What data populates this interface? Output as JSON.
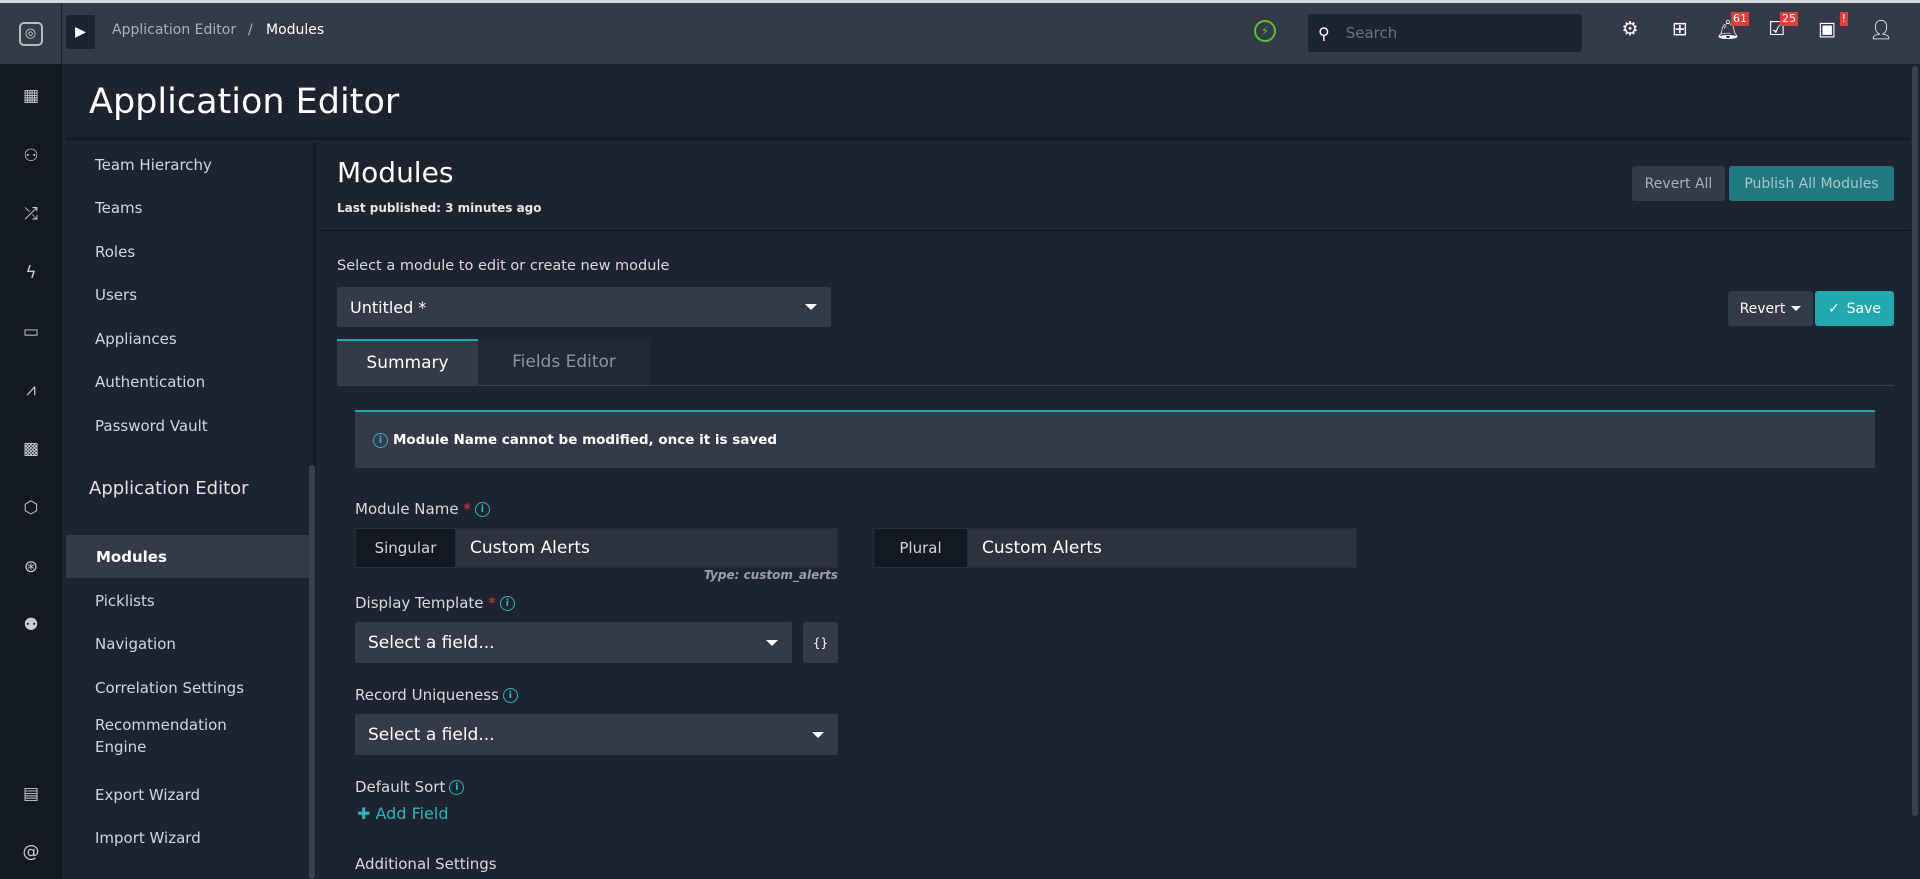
{
  "breadcrumb": {
    "parent": "Application Editor",
    "separator": "/",
    "current": "Modules"
  },
  "topbar": {
    "search_placeholder": "Search",
    "notifications_count": "61",
    "tasks_count": "25",
    "system_alert": "!"
  },
  "page_title": "Application Editor",
  "leftnav": {
    "items": [
      "Team Hierarchy",
      "Teams",
      "Roles",
      "Users",
      "Appliances",
      "Authentication",
      "Password Vault"
    ],
    "section": "Application Editor",
    "section_items": [
      "Modules",
      "Picklists",
      "Navigation",
      "Correlation Settings",
      "Recommendation Engine",
      "Export Wizard",
      "Import Wizard"
    ]
  },
  "main": {
    "title": "Modules",
    "last_published": "Last published: 3 minutes ago",
    "revert_all": "Revert All",
    "publish_all": "Publish All Modules",
    "select_label": "Select a module to edit or create new module",
    "selected_module": "Untitled *",
    "revert": "Revert",
    "save": "Save",
    "tabs": [
      "Summary",
      "Fields Editor"
    ],
    "info_message": "Module Name cannot be modified, once it is saved",
    "module_name_label": "Module Name",
    "singular_label": "Singular",
    "singular_value": "Custom Alerts",
    "plural_label": "Plural",
    "plural_value": "Custom Alerts",
    "type_hint": "Type: custom_alerts",
    "display_template_label": "Display Template",
    "display_template_placeholder": "Select a field...",
    "template_button": "{}",
    "record_uniqueness_label": "Record Uniqueness",
    "record_uniqueness_placeholder": "Select a field...",
    "default_sort_label": "Default Sort",
    "add_field": "Add Field",
    "additional_settings_label": "Additional Settings"
  },
  "colors": {
    "accent": "#24a8b0",
    "badge": "#e03c3c",
    "topbar": "#343a47",
    "background": "#1e2330"
  }
}
